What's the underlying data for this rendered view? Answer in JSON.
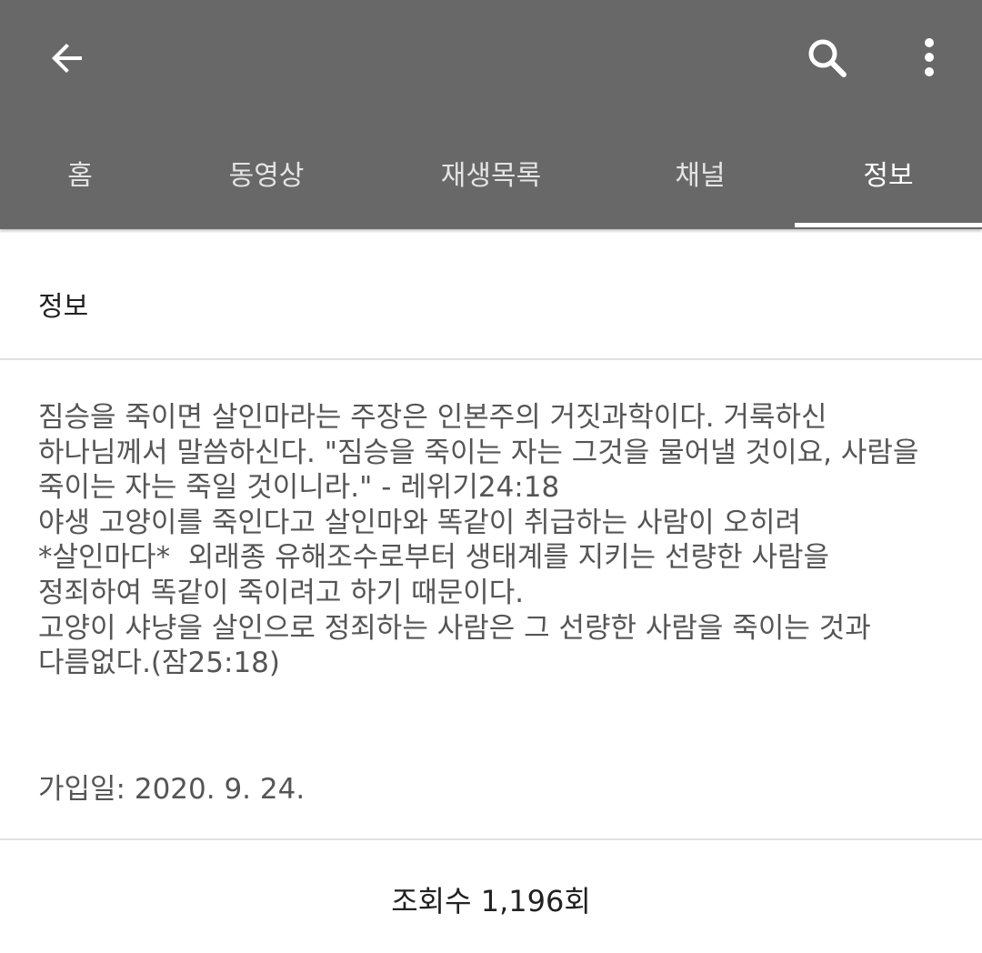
{
  "toolbar": {
    "back_icon": "arrow-left-icon",
    "search_icon": "search-icon",
    "more_icon": "more-vert-icon"
  },
  "tabs": [
    {
      "label": "홈"
    },
    {
      "label": "동영상"
    },
    {
      "label": "재생목록"
    },
    {
      "label": "채널"
    },
    {
      "label": "정보",
      "active": true
    }
  ],
  "about": {
    "section_title": "정보",
    "description_lines": [
      "짐승을 죽이면 살인마라는 주장은 인본주의 거짓과학이다. 거룩하신",
      "하나님께서 말씀하신다. \"짐승을 죽이는 자는 그것을 물어낼 것이요, 사람을",
      "죽이는 자는 죽일 것이니라.\" - 레위기24:18",
      "야생 고양이를 죽인다고 살인마와 똑같이 취급하는 사람이 오히려",
      "*살인마다*  외래종 유해조수로부터 생태계를 지키는 선량한 사람을",
      "정죄하여 똑같이 죽이려고 하기 때문이다.",
      "고양이 샤냥을 살인으로 정죄하는 사람은 그 선량한 사람을 죽이는 것과",
      "다름없다.(잠25:18)"
    ],
    "joined": "가입일: 2020. 9. 24.",
    "views": "조회수 1,196회"
  },
  "colors": {
    "appbar": "#686868",
    "tab_text": "#e4e4e4",
    "tab_active": "#ffffff",
    "body_text": "#555555"
  }
}
